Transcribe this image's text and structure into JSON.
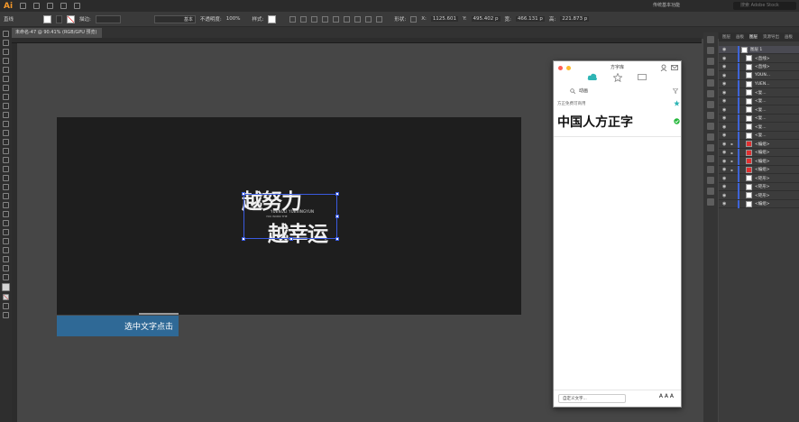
{
  "app": {
    "logo": "Ai",
    "workspace": "传统基本功能",
    "search_placeholder": "搜索 Adobe Stock"
  },
  "control_bar": {
    "selection_label": "直线",
    "stroke_label": "描边:",
    "stroke_style": "基本",
    "opacity_label": "不透明度:",
    "opacity_value": "100%",
    "style_label": "样式:",
    "shape_label": "形状:",
    "x_label": "X:",
    "x_value": "1125.601",
    "y_label": "Y:",
    "y_value": "495.402 p",
    "w_label": "宽:",
    "w_value": "466.131 p",
    "h_label": "高:",
    "h_value": "221.873 p"
  },
  "document": {
    "tab_title": "未命名-47 @ 90.41% (RGB/GPU 预览)"
  },
  "artwork": {
    "line1": "越努力",
    "line2": "越幸运",
    "pinyin": "YUENULI YUEXINGYUN",
    "small": "YOU WORK THE"
  },
  "banner": {
    "text": "选中文字点击"
  },
  "font_panel": {
    "title": "方字库",
    "search_value": "动画",
    "category": "方正免费可商用",
    "font_name": "中国人方正字",
    "custom_text": "自定义文字...",
    "size_label": "A A A"
  },
  "layers_panel": {
    "tabs": [
      "图层",
      "画板",
      "图层",
      "资源导出",
      "画板"
    ],
    "rows": [
      {
        "name": "图层 1",
        "expanded": true,
        "thumb": "white"
      },
      {
        "name": "<直线>",
        "thumb": "white"
      },
      {
        "name": "<直线>",
        "thumb": "white"
      },
      {
        "name": "YOUN...",
        "thumb": "white"
      },
      {
        "name": "YUEN...",
        "thumb": "white"
      },
      {
        "name": "<复...",
        "thumb": "white"
      },
      {
        "name": "<复...",
        "thumb": "white"
      },
      {
        "name": "<复...",
        "thumb": "white"
      },
      {
        "name": "<复...",
        "thumb": "white"
      },
      {
        "name": "<复...",
        "thumb": "white"
      },
      {
        "name": "<复...",
        "thumb": "white"
      },
      {
        "name": "<编组>",
        "thumb": "red"
      },
      {
        "name": "<编组>",
        "thumb": "red"
      },
      {
        "name": "<编组>",
        "thumb": "red"
      },
      {
        "name": "<编组>",
        "thumb": "red"
      },
      {
        "name": "<矩形>",
        "thumb": "white"
      },
      {
        "name": "<矩形>",
        "thumb": "white"
      },
      {
        "name": "<矩形>",
        "thumb": "white"
      },
      {
        "name": "<编组>",
        "thumb": "white"
      }
    ]
  },
  "colors": {
    "accent": "#3a5ae0",
    "banner": "#2f6996",
    "artboard": "#1e1e1e",
    "plugin_teal": "#2fb5b5",
    "ai_orange": "#f2972a"
  }
}
